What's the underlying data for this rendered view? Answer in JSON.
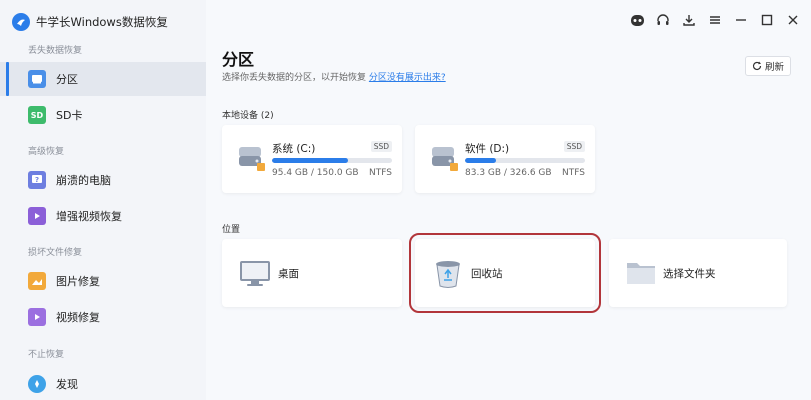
{
  "app": {
    "title": "牛学长Windows数据恢复"
  },
  "sidebar": {
    "sections": [
      {
        "label": "丢失数据恢复"
      },
      {
        "label": "高级恢复"
      },
      {
        "label": "损坏文件修复"
      },
      {
        "label": "不止恢复"
      }
    ],
    "items": [
      {
        "label": "分区",
        "icon": "partition-icon"
      },
      {
        "label": "SD卡",
        "icon": "sd-card-icon"
      },
      {
        "label": "崩溃的电脑",
        "icon": "crashed-pc-icon"
      },
      {
        "label": "增强视频恢复",
        "icon": "video-recovery-icon"
      },
      {
        "label": "图片修复",
        "icon": "photo-repair-icon"
      },
      {
        "label": "视频修复",
        "icon": "video-repair-icon"
      },
      {
        "label": "发现",
        "icon": "discover-icon"
      }
    ]
  },
  "main": {
    "title": "分区",
    "subtitle": "选择你丢失数据的分区，以开始恢复",
    "subtitle_link": "分区没有展示出来?",
    "refresh_label": "刷新",
    "local_devices_label": "本地设备 (2)",
    "drives": [
      {
        "name": "系统 (C:)",
        "badge": "SSD",
        "size": "95.4 GB / 150.0 GB",
        "fs": "NTFS",
        "used_fraction": 0.636
      },
      {
        "name": "软件 (D:)",
        "badge": "SSD",
        "size": "83.3 GB / 326.6 GB",
        "fs": "NTFS",
        "used_fraction": 0.255
      }
    ],
    "location_label": "位置",
    "locations": [
      {
        "label": "桌面",
        "icon": "desktop-icon"
      },
      {
        "label": "回收站",
        "icon": "recycle-bin-icon"
      },
      {
        "label": "选择文件夹",
        "icon": "folder-icon"
      }
    ]
  },
  "colors": {
    "accent": "#2b7de9",
    "selection": "#b2363b"
  }
}
